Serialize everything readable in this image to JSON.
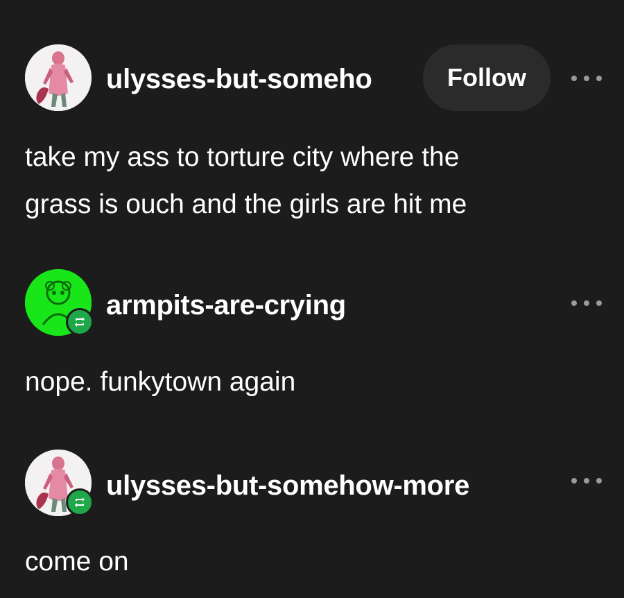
{
  "posts": [
    {
      "username": "ulysses-but-someho",
      "follow_label": "Follow",
      "text_lines": [
        "take my ass to torture city where the",
        "grass is ouch and the girls are hit me"
      ],
      "avatar_icon": "pink-figure-avatar",
      "reblog": false
    },
    {
      "username": "armpits-are-crying",
      "text_lines": [
        "nope. funkytown again"
      ],
      "avatar_icon": "green-figure-avatar",
      "reblog": true
    },
    {
      "username": "ulysses-but-somehow-more",
      "text_lines": [
        "come on"
      ],
      "avatar_icon": "pink-figure-avatar",
      "reblog": true
    }
  ],
  "colors": {
    "background": "#1c1c1c",
    "follow_button": "#2b2b2b",
    "reblog_badge": "#1fa84a",
    "text": "#ffffff",
    "dots": "#9a9a9a"
  },
  "icons": {
    "more": "more-options-icon",
    "reblog": "reblog-icon"
  }
}
